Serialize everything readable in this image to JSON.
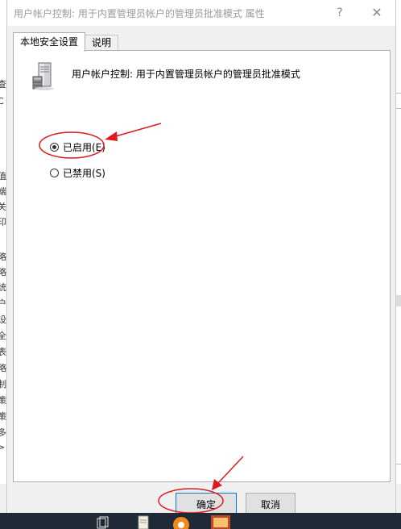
{
  "window": {
    "title": "用户帐户控制: 用于内置管理员帐户的管理员批准模式 属性",
    "help_glyph": "?",
    "close_glyph": "✕"
  },
  "tabs": [
    {
      "label": "本地安全设置",
      "active": true
    },
    {
      "label": "说明",
      "active": false
    }
  ],
  "policy": {
    "name": "用户帐户控制: 用于内置管理员帐户的管理员批准模式",
    "icon": "server-policy-icon"
  },
  "options": [
    {
      "label": "已启用(E)",
      "checked": true
    },
    {
      "label": "已禁用(S)",
      "checked": false
    }
  ],
  "buttons": {
    "ok": "确定",
    "cancel": "取消"
  },
  "background_fragments": [
    "查",
    "C",
    "值",
    "端",
    "关",
    "印",
    "略",
    "略",
    "统",
    "户",
    "设",
    "全",
    "表",
    "略",
    "制",
    "策",
    "策",
    "多",
    ">"
  ],
  "colors": {
    "annotation_red": "#e0191d",
    "focus_blue": "#0078d7",
    "taskbar": "#1f2a36"
  }
}
